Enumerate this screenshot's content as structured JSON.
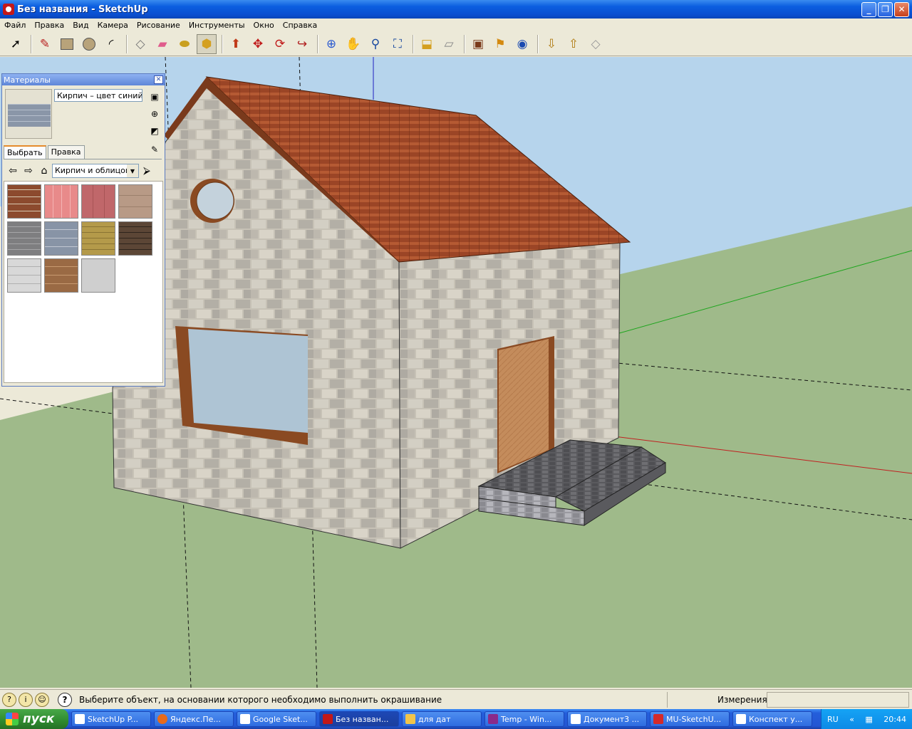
{
  "window": {
    "title": "Без названия - SketchUp"
  },
  "menu": [
    "Файл",
    "Правка",
    "Вид",
    "Камера",
    "Рисование",
    "Инструменты",
    "Окно",
    "Справка"
  ],
  "toolbar": {
    "tools": [
      "select-icon",
      "pencil-icon",
      "rectangle-icon",
      "circle-icon",
      "arc-icon",
      "eraser-icon",
      "tape-eraser-icon",
      "tape-measure-icon",
      "paint-bucket-icon",
      "push-pull-icon",
      "move-icon",
      "rotate-icon",
      "follow-me-icon",
      "orbit-icon",
      "pan-icon",
      "zoom-icon",
      "zoom-extents-icon",
      "add-location-icon",
      "terrain-icon",
      "model-info-icon",
      "geo-icon",
      "get-models-icon",
      "share-model-icon",
      "3d-warehouse-icon"
    ],
    "active_tool": "paint-bucket-icon"
  },
  "materials": {
    "title": "Материалы",
    "current_material": "Кирпич – цвет синий",
    "tabs": [
      "Выбрать",
      "Правка"
    ],
    "active_tab": "Выбрать",
    "category": "Кирпич и облицовка",
    "swatches": [
      {
        "name": "brick-red",
        "color": "#8c4a2e"
      },
      {
        "name": "tile-pink",
        "color": "#e88a8a"
      },
      {
        "name": "tile-red",
        "color": "#c0676a"
      },
      {
        "name": "stone-beige",
        "color": "#b89a86"
      },
      {
        "name": "stone-gray",
        "color": "#7e7e80"
      },
      {
        "name": "brick-blue",
        "color": "#8894a6"
      },
      {
        "name": "brick-yellow",
        "color": "#b49a4a"
      },
      {
        "name": "brick-dark",
        "color": "#5c4636"
      },
      {
        "name": "siding-white",
        "color": "#d8d8d8"
      },
      {
        "name": "wood-brown",
        "color": "#9a6a44"
      },
      {
        "name": "stucco-gray",
        "color": "#cfcfcf"
      }
    ]
  },
  "status": {
    "message": "Выберите объект, на основании которого необходимо выполнить окрашивание",
    "measurements_label": "Измерения"
  },
  "taskbar": {
    "start_label": "пуск",
    "tasks": [
      "SketchUp P...",
      "Яндекс.Пе...",
      "Google Sket...",
      "Без назван...",
      "для дат",
      "Temp - Win...",
      "Документ3 ...",
      "MU-SketchU...",
      "Конспект у..."
    ],
    "active_task": 3,
    "lang": "RU",
    "clock": "20:44"
  },
  "colors": {
    "sky": "#b6d4ec",
    "ground": "#9fba8a",
    "roof": "#9c4a2a",
    "wall": "#c2bfb4",
    "door": "#c28a5a",
    "glass": "#aec4d4"
  }
}
